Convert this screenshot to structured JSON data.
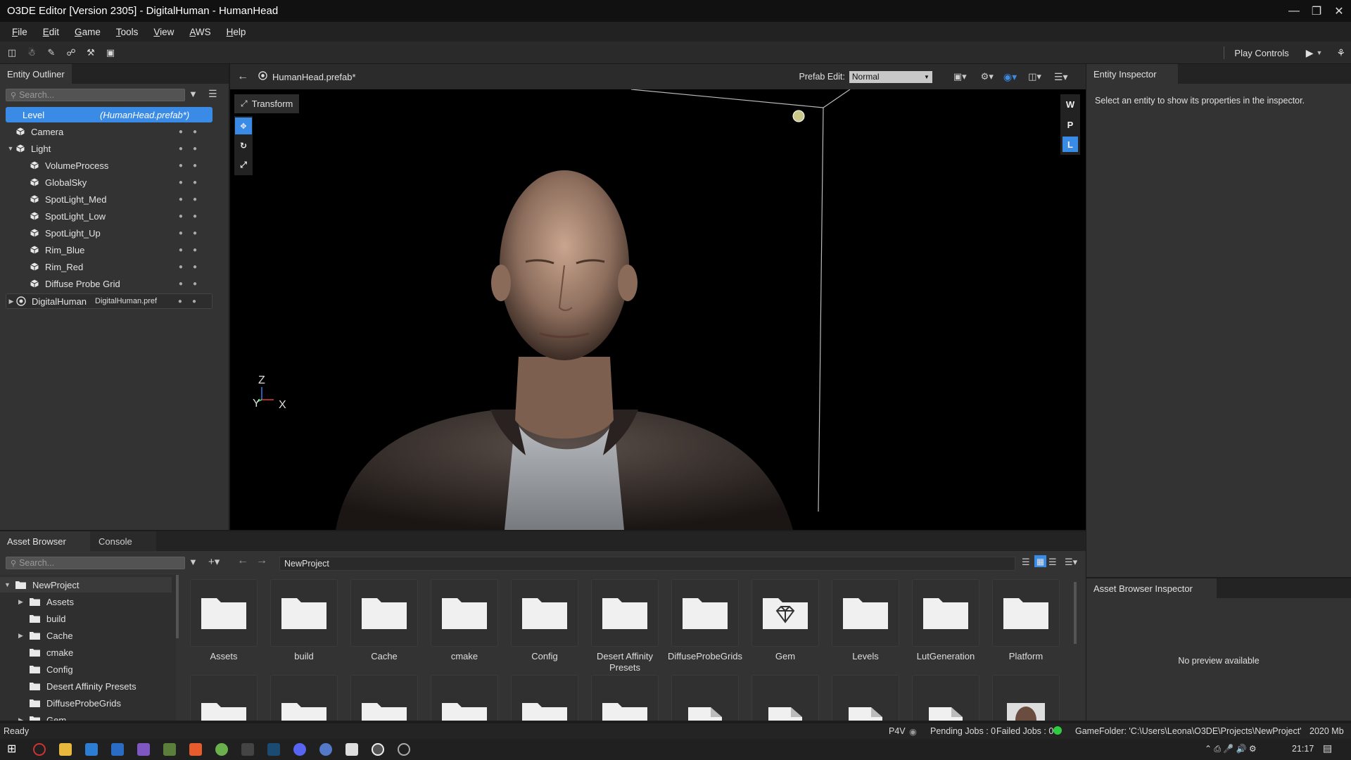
{
  "window": {
    "title": "O3DE Editor [Version 2305] - DigitalHuman - HumanHead",
    "controls": [
      "minimize-icon",
      "restore-icon",
      "close-icon"
    ]
  },
  "menu": [
    "File",
    "Edit",
    "Game",
    "Tools",
    "View",
    "AWS",
    "Help"
  ],
  "toolbar": {
    "icons": [
      "snap-icon",
      "physics-icon",
      "script-icon",
      "graph-icon",
      "tools-icon",
      "material-icon"
    ],
    "play_controls_label": "Play Controls"
  },
  "outliner": {
    "tab": "Entity Outliner",
    "search_placeholder": "Search...",
    "level": {
      "label": "Level",
      "prefab": "(HumanHead.prefab*)"
    },
    "entities": [
      {
        "name": "Camera",
        "indent": 1
      },
      {
        "name": "Light",
        "indent": 1,
        "expanded": true
      },
      {
        "name": "VolumeProcess",
        "indent": 2
      },
      {
        "name": "GlobalSky",
        "indent": 2
      },
      {
        "name": "SpotLight_Med",
        "indent": 2
      },
      {
        "name": "SpotLight_Low",
        "indent": 2
      },
      {
        "name": "SpotLight_Up",
        "indent": 2
      },
      {
        "name": "Rim_Blue",
        "indent": 2
      },
      {
        "name": "Rim_Red",
        "indent": 2
      },
      {
        "name": "Diffuse Probe Grid",
        "indent": 2
      }
    ],
    "prefab_entity": {
      "name": "DigitalHuman",
      "prefab": "DigitalHuman.pref"
    }
  },
  "viewport": {
    "prefab_name": "HumanHead.prefab*",
    "prefab_edit_label": "Prefab Edit:",
    "prefab_edit_value": "Normal",
    "transform_label": "Transform",
    "side_buttons": [
      "W",
      "P",
      "L"
    ],
    "axes": {
      "z": "Z",
      "y": "Y",
      "x": "X"
    }
  },
  "inspector": {
    "tab": "Entity Inspector",
    "message": "Select an entity to show its properties in the inspector."
  },
  "asset_browser": {
    "tabs": [
      "Asset Browser",
      "Console"
    ],
    "search_placeholder": "Search...",
    "path": "NewProject",
    "tree": [
      {
        "name": "NewProject",
        "level": 0,
        "expanded": true
      },
      {
        "name": "Assets",
        "level": 1,
        "expandable": true
      },
      {
        "name": "build",
        "level": 1
      },
      {
        "name": "Cache",
        "level": 1,
        "expandable": true
      },
      {
        "name": "cmake",
        "level": 1
      },
      {
        "name": "Config",
        "level": 1
      },
      {
        "name": "Desert Affinity Presets",
        "level": 1
      },
      {
        "name": "DiffuseProbeGrids",
        "level": 1
      },
      {
        "name": "Gem",
        "level": 1,
        "expandable": true
      }
    ],
    "folders": [
      {
        "label": "Assets",
        "icon": "folder-icon"
      },
      {
        "label": "build",
        "icon": "folder-icon"
      },
      {
        "label": "Cache",
        "icon": "folder-icon"
      },
      {
        "label": "cmake",
        "icon": "folder-icon"
      },
      {
        "label": "Config",
        "icon": "folder-icon"
      },
      {
        "label": "Desert Affinity Presets",
        "icon": "folder-icon"
      },
      {
        "label": "DiffuseProbeGrids",
        "icon": "folder-icon"
      },
      {
        "label": "Gem",
        "icon": "gem-icon"
      },
      {
        "label": "Levels",
        "icon": "folder-icon"
      },
      {
        "label": "LutGeneration",
        "icon": "folder-icon"
      },
      {
        "label": "Platform",
        "icon": "folder-icon"
      }
    ],
    "second_row_icons": [
      "folder-icon",
      "folder-icon",
      "folder-icon",
      "folder-icon",
      "folder-icon",
      "folder-icon",
      "file-icon",
      "file-icon",
      "file-icon",
      "file-icon",
      "head-thumbnail"
    ]
  },
  "asset_inspector": {
    "tab": "Asset Browser Inspector",
    "message": "No preview available"
  },
  "status": {
    "left": "Ready",
    "p4v": "P4V",
    "pending": "Pending Jobs : 0",
    "failed": "Failed Jobs : 0",
    "game_folder": "GameFolder: 'C:\\Users\\Leona\\O3DE\\Projects\\NewProject'",
    "memory": "2020 Mb"
  },
  "taskbar": {
    "time": "21:17",
    "colors": {
      "accent": "#3a8be5",
      "status_ok": "#2ecc40"
    }
  }
}
